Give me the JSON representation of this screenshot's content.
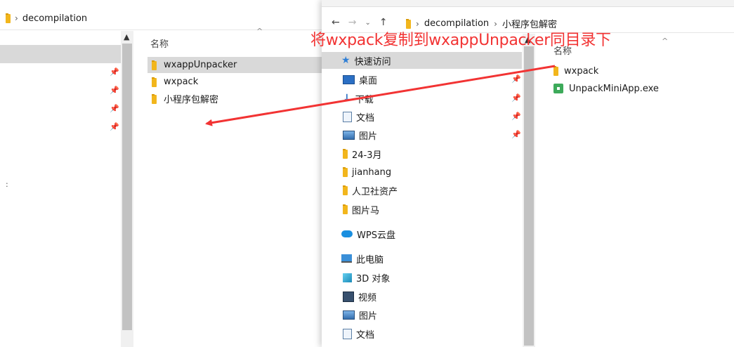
{
  "left_window": {
    "breadcrumb": [
      "decompilation"
    ],
    "column_header": "名称",
    "files": [
      {
        "name": "wxappUnpacker",
        "selected": true
      },
      {
        "name": "wxpack",
        "selected": false
      },
      {
        "name": "小程序包解密",
        "selected": false
      }
    ],
    "stray_text": ":"
  },
  "right_window": {
    "breadcrumb": [
      "decompilation",
      "小程序包解密"
    ],
    "column_header": "名称",
    "nav_items": [
      {
        "label": "快速访问",
        "icon": "star-icon"
      },
      {
        "label": "桌面",
        "icon": "desktop-icon"
      },
      {
        "label": "下载",
        "icon": "download-icon"
      },
      {
        "label": "文档",
        "icon": "documents-icon"
      },
      {
        "label": "图片",
        "icon": "pictures-icon"
      },
      {
        "label": "24-3月",
        "icon": "folder-icon"
      },
      {
        "label": "jianhang",
        "icon": "folder-icon"
      },
      {
        "label": "人卫社资产",
        "icon": "folder-icon"
      },
      {
        "label": "图片马",
        "icon": "folder-icon"
      },
      {
        "label": "WPS云盘",
        "icon": "cloud-icon"
      },
      {
        "label": "此电脑",
        "icon": "pc-icon"
      },
      {
        "label": "3D 对象",
        "icon": "3d-objects-icon"
      },
      {
        "label": "视频",
        "icon": "videos-icon"
      },
      {
        "label": "图片",
        "icon": "pictures-icon"
      },
      {
        "label": "文档",
        "icon": "documents-icon"
      }
    ],
    "files": [
      {
        "name": "wxpack",
        "icon": "folder-icon"
      },
      {
        "name": "UnpackMiniApp.exe",
        "icon": "exe-icon"
      }
    ]
  },
  "annotation": {
    "text": "将wxpack复制到wxappUnpacker同目录下",
    "color": "#f23333"
  }
}
